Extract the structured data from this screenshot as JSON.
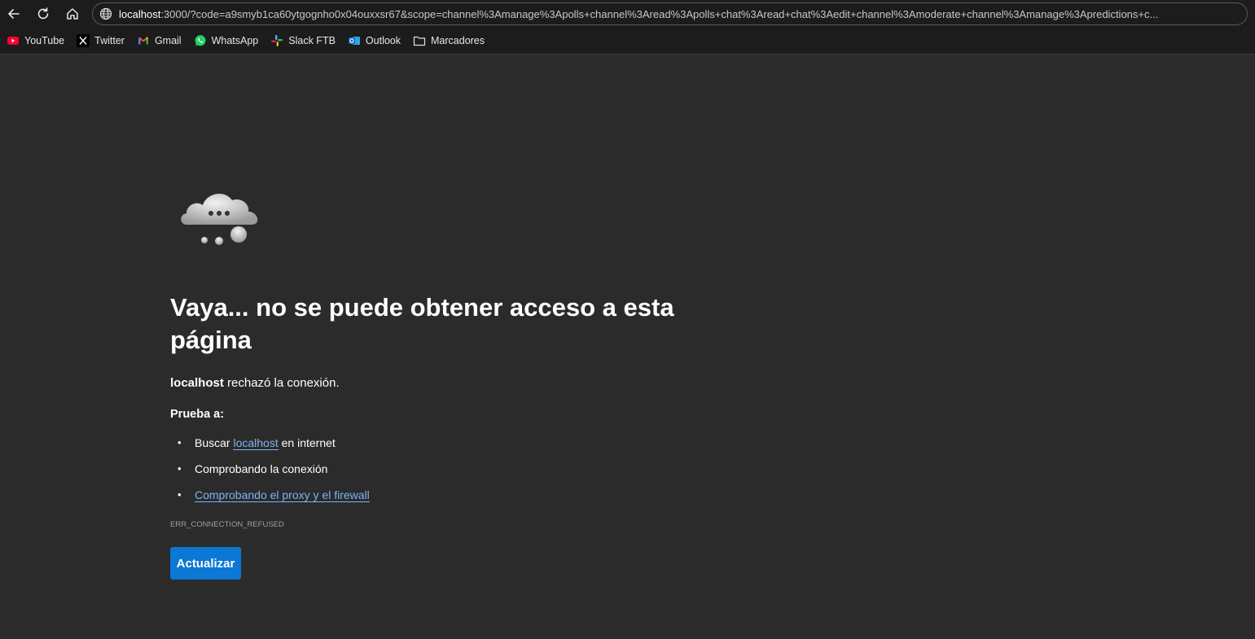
{
  "browser": {
    "url_host": "localhost",
    "url_rest": ":3000/?code=a9smyb1ca60ytgognho0x04ouxxsr67&scope=channel%3Amanage%3Apolls+channel%3Aread%3Apolls+chat%3Aread+chat%3Aedit+channel%3Amoderate+channel%3Amanage%3Apredictions+c...",
    "bookmarks": [
      {
        "label": "YouTube",
        "icon": "youtube-icon"
      },
      {
        "label": "Twitter",
        "icon": "x-twitter-icon"
      },
      {
        "label": "Gmail",
        "icon": "gmail-icon"
      },
      {
        "label": "WhatsApp",
        "icon": "whatsapp-icon"
      },
      {
        "label": "Slack FTB",
        "icon": "slack-icon"
      },
      {
        "label": "Outlook",
        "icon": "outlook-icon"
      },
      {
        "label": "Marcadores",
        "icon": "folder-icon"
      }
    ]
  },
  "error": {
    "title": "Vaya... no se puede obtener acceso a esta página",
    "host": "localhost",
    "reason_rest": " rechazó la conexión.",
    "try_label": "Prueba a:",
    "suggestions": {
      "s1_prefix": "Buscar ",
      "s1_link": "localhost",
      "s1_suffix": " en internet",
      "s2": "Comprobando la conexión",
      "s3_link": "Comprobando el proxy y el firewall"
    },
    "code": "ERR_CONNECTION_REFUSED",
    "refresh_label": "Actualizar"
  },
  "colors": {
    "background": "#2b2b2b",
    "link": "#7cb3f5",
    "button": "#0a78d4"
  }
}
